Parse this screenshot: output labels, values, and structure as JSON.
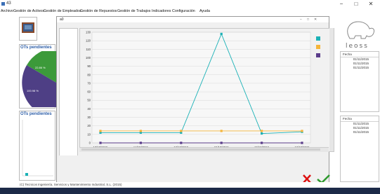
{
  "window": {
    "title": "43"
  },
  "window_controls": {
    "minimize": "−",
    "maximize": "□",
    "close": "✕"
  },
  "menu": [
    "Archivo",
    "Gestión de Activos",
    "Gestión de Empleados",
    "Gestión de Repuestos",
    "Gestión de Trabajos",
    "Indicadores",
    "Configuración",
    "Ayuda"
  ],
  "left": {
    "panel1_title": "OTs pendientes",
    "pie_labels": [
      "22.86 %",
      "100.98 %"
    ],
    "panel2_title": "OTs pendientes"
  },
  "child_window": {
    "title": "a0"
  },
  "logo": {
    "text": "leoss"
  },
  "right_tables": [
    {
      "header": "Fecha",
      "rows": [
        "01/11/2015",
        "01/11/2015",
        "01/11/2015"
      ]
    },
    {
      "header": "Fecha",
      "rows": [
        "01/11/2015",
        "01/11/2015",
        "01/11/2015"
      ]
    }
  ],
  "buttons": {
    "exit": "Salir",
    "accept": "Aceptar"
  },
  "status": {
    "text": "(C) Tecnicos Ingeniería, Servicios y Mantenimiento Industrial, S.L. (2015)"
  },
  "colors": {
    "series_teal": "#1ab1b6",
    "series_orange": "#f5b53a",
    "series_purple": "#5a3c8a",
    "pie_purple": "#4e3f85",
    "pie_green": "#3c9a3a",
    "accent_blue": "#2d5ea8"
  },
  "chart_data": {
    "type": "line",
    "categories": [
      "13/10/2015",
      "14/10/2015",
      "12/10/2015",
      "15/10/2015",
      "15/10/2015",
      "16/10/2015"
    ],
    "yticks": [
      0,
      10,
      20,
      30,
      40,
      50,
      60,
      70,
      80,
      90,
      100,
      110,
      120,
      130
    ],
    "ylim": [
      0,
      130
    ],
    "grid": true,
    "legend": "right",
    "series": [
      {
        "values": [
          12,
          12,
          12,
          128,
          11,
          13
        ],
        "color": "#1ab1b6"
      },
      {
        "values": [
          14,
          14,
          14,
          14,
          14,
          14
        ],
        "color": "#f5b53a"
      },
      {
        "values": [
          0,
          0,
          0,
          0,
          0,
          0
        ],
        "color": "#5a3c8a"
      }
    ]
  }
}
